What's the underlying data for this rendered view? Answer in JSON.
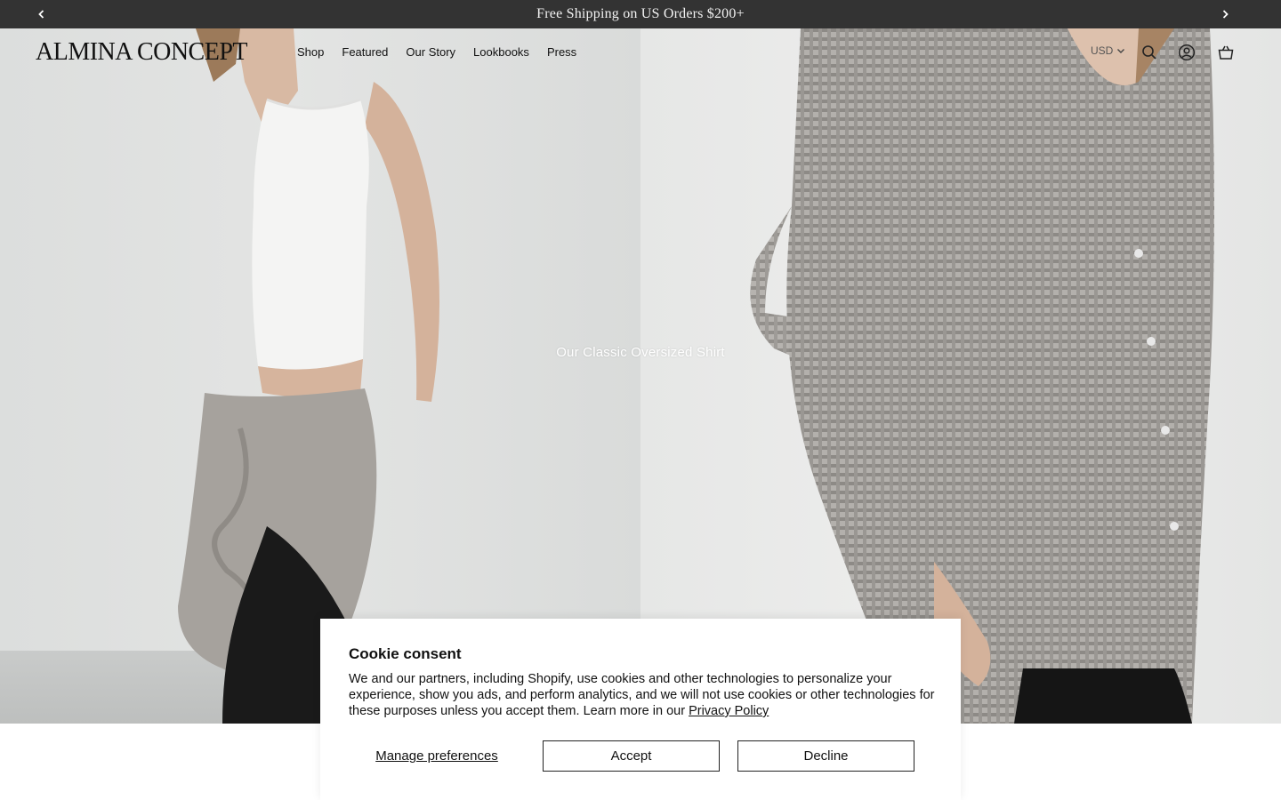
{
  "announcement": {
    "text": "Free Shipping on US Orders $200+",
    "prev_icon": "chevron-left-icon",
    "next_icon": "chevron-right-icon"
  },
  "header": {
    "logo": "ALMINA CONCEPT",
    "nav": [
      "Shop",
      "Featured",
      "Our Story",
      "Lookbooks",
      "Press"
    ],
    "currency": "USD",
    "icons": [
      "search-icon",
      "account-icon",
      "cart-icon"
    ]
  },
  "hero": {
    "caption": "Our Classic Oversized Shirt"
  },
  "cookie": {
    "title": "Cookie consent",
    "body": "We and our partners, including Shopify, use cookies and other technologies to personalize your experience, show you ads, and perform analytics, and we will not use cookies or other technologies for these purposes unless you accept them. Learn more in our ",
    "link": "Privacy Policy",
    "manage": "Manage preferences",
    "accept": "Accept",
    "decline": "Decline"
  },
  "colors": {
    "announcement_bg": "#333333",
    "announcement_text": "#f2f2f2",
    "button_border": "#222222"
  }
}
